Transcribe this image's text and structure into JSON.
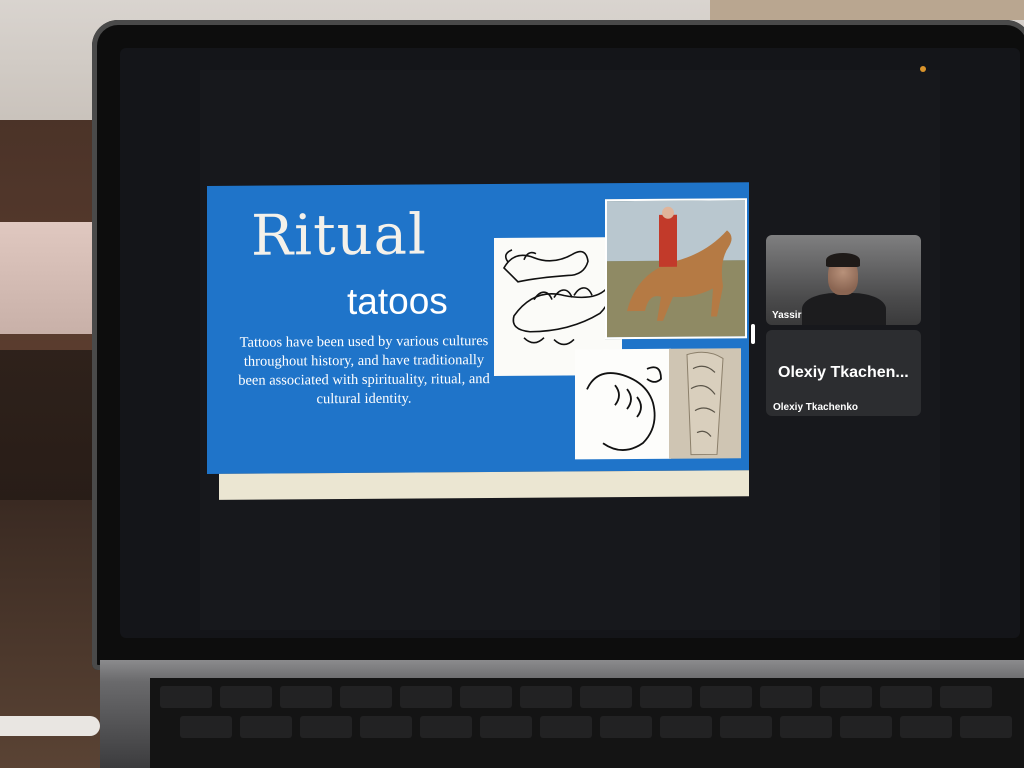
{
  "slide": {
    "title": "Ritual",
    "subtitle": "tatoos",
    "body": "Tattoos have been used by various cultures throughout history, and have traditionally been associated with spirituality, ritual, and cultural identity."
  },
  "participants": [
    {
      "display_name": "Yassir",
      "has_video": true
    },
    {
      "display_name": "Olexiy Tkachen...",
      "label": "Olexiy Tkachenko",
      "has_video": false
    }
  ],
  "colors": {
    "slide_blue": "#1f74c9",
    "slide_strip": "#ebe6d2",
    "tile_bg": "#2c2d30",
    "camera_indicator": "#d9932b"
  },
  "icons": {
    "camera_indicator": "camera-dot-icon"
  }
}
